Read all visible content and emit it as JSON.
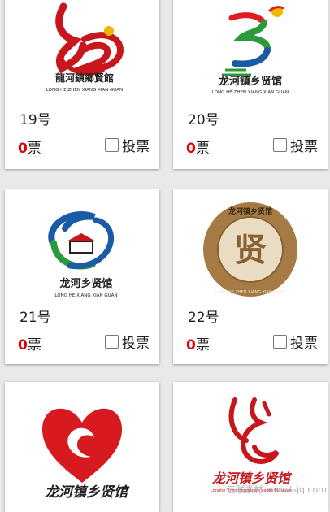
{
  "cards": [
    {
      "number": "19号",
      "votes": "0",
      "votes_unit": "票",
      "vote_label": "投票",
      "logo_title": "龍河鎮鄉賢館",
      "logo_subtitle": "LONG HE ZHEN XIANG XIAN GUAN"
    },
    {
      "number": "20号",
      "votes": "0",
      "votes_unit": "票",
      "vote_label": "投票",
      "logo_title": "龙河镇乡贤馆",
      "logo_subtitle": "LONG HE ZHEN XIANG XIAN GUAN"
    },
    {
      "number": "21号",
      "votes": "0",
      "votes_unit": "票",
      "vote_label": "投票",
      "logo_title": "龙河乡贤馆",
      "logo_subtitle": "LONG HE XIANG XIAN GUAN"
    },
    {
      "number": "22号",
      "votes": "0",
      "votes_unit": "票",
      "vote_label": "投票",
      "logo_title": "龙河镇乡贤馆",
      "logo_subtitle": "LONG HE ZHEN XIANG XIAN GUAN",
      "logo_glyph": "贤"
    },
    {
      "logo_title": "龙河镇乡贤馆"
    },
    {
      "logo_title": "龙河镇乡贤馆",
      "logo_subtitle": "Longhe Town Hometown sages Museum"
    }
  ],
  "watermark": "三联素材 www.lsjq.com",
  "colors": {
    "vote_count": "#e00000",
    "logo_red": "#c8161d",
    "logo_blue": "#1b5aa6",
    "logo_gold": "#a57a45"
  }
}
